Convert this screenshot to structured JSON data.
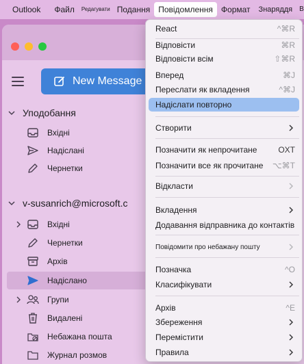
{
  "menubar": {
    "items": [
      {
        "label": "Outlook"
      },
      {
        "label": "Файл"
      },
      {
        "label": "Редагувати"
      },
      {
        "label": "Подання"
      },
      {
        "label": "Повідомлення"
      },
      {
        "label": "Формат"
      },
      {
        "label": "Знаряддя"
      },
      {
        "label": "Вікно"
      }
    ]
  },
  "toolbar": {
    "new_message_label": "New Message"
  },
  "sidebar": {
    "favorites": {
      "header": "Уподобання",
      "items": [
        {
          "label": "Вхідні",
          "icon": "inbox-icon"
        },
        {
          "label": "Надіслані",
          "icon": "sent-icon"
        },
        {
          "label": "Чернетки",
          "icon": "drafts-icon"
        }
      ]
    },
    "account": {
      "header": "v-susanrich@microsoft.c",
      "items": [
        {
          "label": "Вхідні",
          "icon": "inbox-icon"
        },
        {
          "label": "Чернетки",
          "icon": "drafts-icon"
        },
        {
          "label": "Архів",
          "icon": "archive-icon"
        },
        {
          "label": "Надіслано",
          "icon": "sent-icon",
          "selected": true
        },
        {
          "label": "Групи",
          "icon": "groups-icon"
        },
        {
          "label": "Видалені",
          "icon": "trash-icon"
        },
        {
          "label": "Небажана пошта",
          "icon": "junk-icon"
        },
        {
          "label": "Журнал розмов",
          "icon": "folder-icon"
        }
      ]
    }
  },
  "menu": {
    "items": [
      {
        "label": "React",
        "shortcut": "^⌘R"
      },
      {
        "label": "Відповісти",
        "shortcut": "⌘R"
      },
      {
        "label": "Відповісти всім",
        "shortcut": "⇧⌘R"
      },
      {
        "label": "Вперед",
        "shortcut": "⌘J"
      },
      {
        "label": "Переслати як вкладення",
        "shortcut": "^⌘J"
      },
      {
        "label": "Надіслати повторно"
      },
      {
        "label": "Створити"
      },
      {
        "label": "Позначити як непрочитане",
        "shortcut": "OXT"
      },
      {
        "label": "Позначити все як прочитане",
        "shortcut": "⌥⌘T"
      },
      {
        "label": "Відкласти"
      },
      {
        "label": "Вкладення"
      },
      {
        "label": "Додавання відправника до контактів"
      },
      {
        "label": "Повідомити про небажану пошту"
      },
      {
        "label": "Позначка",
        "shortcut": "^O"
      },
      {
        "label": "Класифікувати"
      },
      {
        "label": "Архів",
        "shortcut": "^E"
      },
      {
        "label": "Збереження"
      },
      {
        "label": "Перемістити"
      },
      {
        "label": "Правила"
      }
    ]
  },
  "colors": {
    "background": "#c989c8",
    "menu_highlight": "#9cbff0",
    "new_message_button": "#3f82d8",
    "traffic_red": "#ff5f57",
    "traffic_yellow": "#febc2e",
    "traffic_green": "#28c840"
  }
}
